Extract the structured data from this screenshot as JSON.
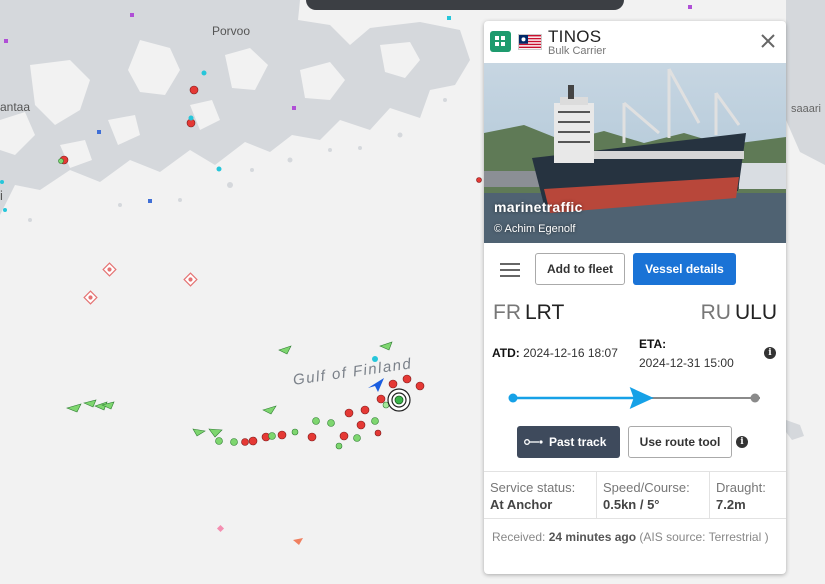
{
  "map": {
    "labels": {
      "porvoo": "Porvoo",
      "vantaa": "antaa",
      "saaari": "saaari",
      "edge_i": "i",
      "gulf": "Gulf of Finland"
    }
  },
  "popup": {
    "vessel_name": "TINOS",
    "vessel_type": "Bulk Carrier",
    "photo_watermark": "marinetraffic",
    "photo_credit": "© Achim Egenolf",
    "add_to_fleet": "Add to fleet",
    "vessel_details": "Vessel details",
    "from": {
      "country": "FR",
      "port": "LRT"
    },
    "to": {
      "country": "RU",
      "port": "ULU"
    },
    "atd_label": "ATD:",
    "atd_value": "2024-12-16 18:07",
    "eta_label": "ETA:",
    "eta_value": "2024-12-31 15:00",
    "voyage_progress": 0.54,
    "past_track": "Past track",
    "route_tool": "Use route tool",
    "service_status_label": "Service status:",
    "service_status_value": "At Anchor",
    "speed_course_label": "Speed/Course:",
    "speed_course_value": "0.5kn / 5°",
    "draught_label": "Draught:",
    "draught_value": "7.2m",
    "received_label": "Received:",
    "received_value": "24 minutes ago",
    "ais_source": "(AIS source: Terrestrial )"
  },
  "colors": {
    "accent_blue": "#1a73d6",
    "track_button": "#3e4a5c",
    "vessel_icon_green": "#1e9b6e",
    "progress": "#16a1e7"
  }
}
